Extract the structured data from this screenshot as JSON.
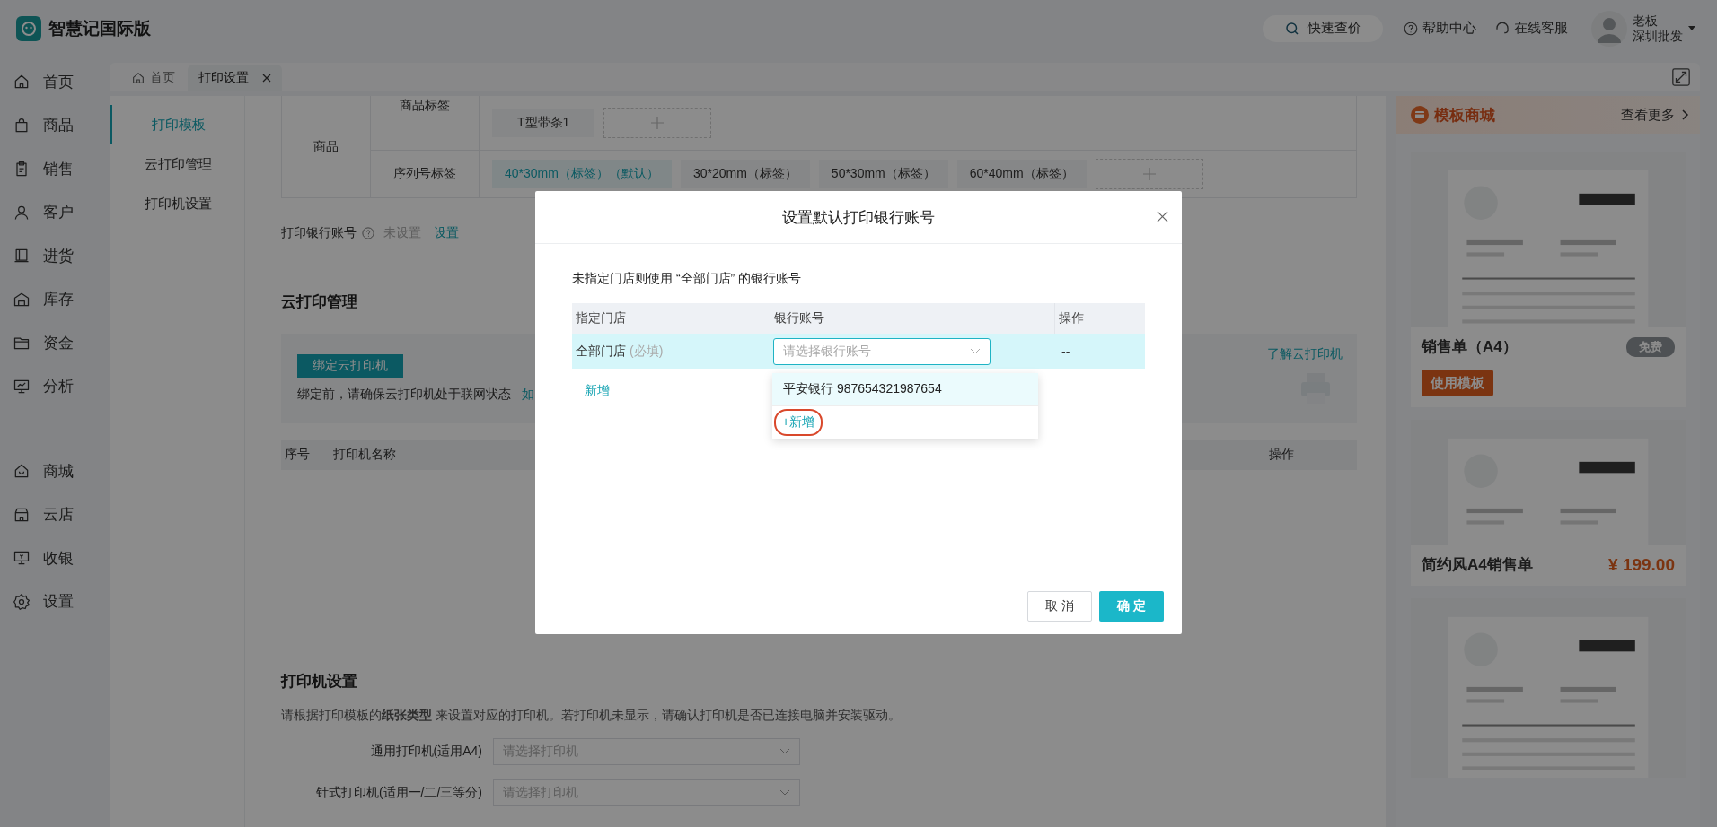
{
  "app": {
    "name": "智慧记国际版"
  },
  "header": {
    "quick_price": "快速查价",
    "help": "帮助中心",
    "support": "在线客服",
    "user": {
      "name": "老板",
      "store": "深圳批发"
    }
  },
  "main_nav": [
    {
      "label": "首页"
    },
    {
      "label": "商品"
    },
    {
      "label": "销售"
    },
    {
      "label": "客户"
    },
    {
      "label": "进货"
    },
    {
      "label": "库存"
    },
    {
      "label": "资金"
    },
    {
      "label": "分析"
    }
  ],
  "extra_nav": [
    {
      "label": "商城"
    },
    {
      "label": "云店"
    },
    {
      "label": "收银"
    },
    {
      "label": "设置"
    }
  ],
  "tabs": [
    {
      "label": "首页",
      "selected": false,
      "closable": false
    },
    {
      "label": "打印设置",
      "selected": true,
      "closable": true
    }
  ],
  "sub_nav": [
    {
      "label": "打印模板",
      "selected": true
    },
    {
      "label": "云打印管理",
      "selected": false
    },
    {
      "label": "打印机设置",
      "selected": false
    }
  ],
  "template_table": {
    "category": "商品",
    "groups": [
      {
        "name": "商品标签",
        "chips": [
          {
            "label": "T型带条1",
            "selected": false
          }
        ]
      },
      {
        "name": "序列号标签",
        "chips": [
          {
            "label": "40*30mm（标签）（默认）",
            "selected": true
          },
          {
            "label": "30*20mm（标签）",
            "selected": false
          },
          {
            "label": "50*30mm（标签）",
            "selected": false
          },
          {
            "label": "60*40mm（标签）",
            "selected": false
          }
        ]
      }
    ]
  },
  "bank_account": {
    "label": "打印银行账号",
    "value": "未设置",
    "action": "设置"
  },
  "cloud_print": {
    "title": "云打印管理",
    "bind_button": "绑定云打印机",
    "notice": "绑定前，请确保云打印机处于联网状态",
    "notice_link": "如",
    "learn_link": "了解云打印机",
    "columns": [
      "序号",
      "打印机名称",
      "操作"
    ]
  },
  "printer_settings": {
    "title": "打印机设置",
    "description": "请根据打印模板的**纸张类型** 来设置对应的打印机。若打印机未显示，请确认打印机是否已连接电脑并安装驱动。",
    "fields": [
      {
        "label": "通用打印机(适用A4)",
        "placeholder": "请选择打印机"
      },
      {
        "label": "针式打印机(适用一/二/三等分)",
        "placeholder": "请选择打印机"
      }
    ]
  },
  "template_store": {
    "title": "模板商城",
    "more": "查看更多",
    "cards": [
      {
        "preview": {
          "kind": "picture"
        },
        "name": "销售单（A4）",
        "badge": "免费",
        "button": "使用模板"
      },
      {
        "preview": {
          "kind": "picture"
        },
        "name": "简约风A4销售单",
        "price": "¥ 199.00"
      },
      {
        "preview": {
          "kind": "picture"
        }
      }
    ]
  },
  "dialog": {
    "title": "设置默认打印银行账号",
    "note": "未指定门店则使用 “全部门店” 的银行账号",
    "columns": [
      "指定门店",
      "银行账号",
      "操作"
    ],
    "rows": [
      {
        "store": "全部门店",
        "hint": "(必填)",
        "account_placeholder": "请选择银行账号",
        "action": "--",
        "selected": true
      }
    ],
    "add_link": "新增",
    "dropdown": {
      "options": [
        {
          "label": "平安银行 987654321987654",
          "hovered": true
        }
      ],
      "add_option": {
        "label": "+新增",
        "highlighted": true
      }
    },
    "buttons": {
      "cancel": "取 消",
      "ok": "确 定"
    }
  }
}
